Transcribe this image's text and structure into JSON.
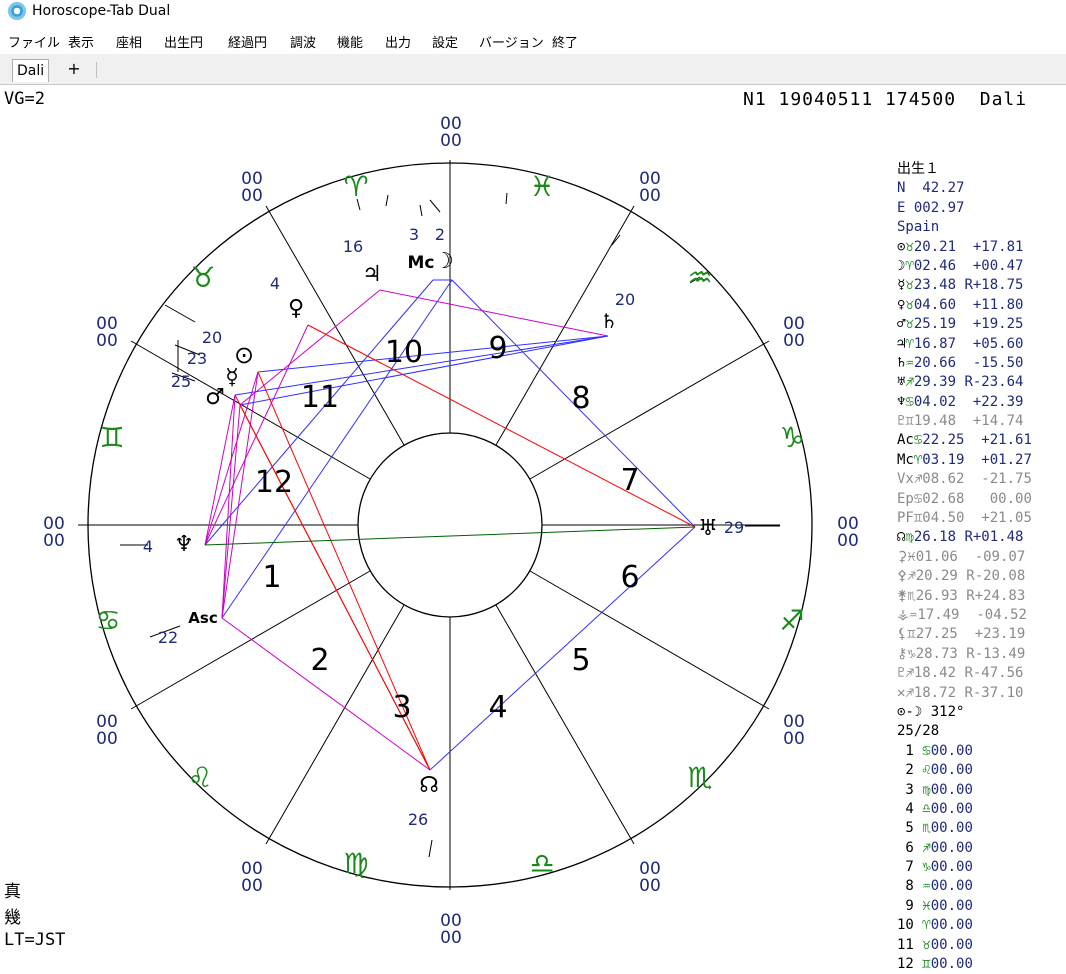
{
  "window": {
    "title": "Horoscope-Tab Dual"
  },
  "menu": [
    "ファイル",
    "表示",
    "座相",
    "出生円",
    "経過円",
    "調波",
    "機能",
    "出力",
    "設定",
    "バージョン",
    "終了"
  ],
  "tabs": {
    "active": "Dali",
    "add": "+"
  },
  "header": {
    "left": "VG=2",
    "right": "N1 19040511 174500  Dali"
  },
  "chart": {
    "ring_labels": "00",
    "houses": [
      "1",
      "2",
      "3",
      "4",
      "5",
      "6",
      "7",
      "8",
      "9",
      "10",
      "11",
      "12"
    ],
    "signs": [
      {
        "name": "aries",
        "glyph": "♈"
      },
      {
        "name": "taurus",
        "glyph": "♉"
      },
      {
        "name": "gemini",
        "glyph": "♊"
      },
      {
        "name": "cancer",
        "glyph": "♋"
      },
      {
        "name": "leo",
        "glyph": "♌"
      },
      {
        "name": "virgo",
        "glyph": "♍"
      },
      {
        "name": "libra",
        "glyph": "♎"
      },
      {
        "name": "scorpio",
        "glyph": "♏"
      },
      {
        "name": "sagittarius",
        "glyph": "♐"
      },
      {
        "name": "capricorn",
        "glyph": "♑"
      },
      {
        "name": "aquarius",
        "glyph": "♒"
      },
      {
        "name": "pisces",
        "glyph": "♓"
      }
    ],
    "planets": [
      {
        "name": "jupiter",
        "glyph": "♃"
      },
      {
        "name": "mc",
        "glyph": "Mc"
      },
      {
        "name": "moon",
        "glyph": "☽"
      },
      {
        "name": "venus",
        "glyph": "♀"
      },
      {
        "name": "sun",
        "glyph": "⊙"
      },
      {
        "name": "mercury",
        "glyph": "☿"
      },
      {
        "name": "mars",
        "glyph": "♂"
      },
      {
        "name": "saturn",
        "glyph": "♄"
      },
      {
        "name": "uranus",
        "glyph": "♅"
      },
      {
        "name": "neptune",
        "glyph": "♆"
      },
      {
        "name": "asc",
        "glyph": "Asc"
      },
      {
        "name": "node",
        "glyph": "☊"
      }
    ],
    "degree_labels": {
      "d16": "16",
      "d3": "3",
      "d2": "2",
      "d4": "4",
      "d20a": "20",
      "d23": "23",
      "d25": "25",
      "d20b": "20",
      "d29": "29",
      "d4n": "4",
      "d22": "22",
      "d26": "26"
    },
    "colors": {
      "circle": "#000000",
      "label": "#1f2a7a",
      "sign": "#1a8a1a",
      "blue": "#3030ff",
      "red": "#ff0000",
      "magenta": "#cc00cc",
      "green": "#006000"
    }
  },
  "side": {
    "title": "出生１",
    "lat": "N  42.27",
    "lon": "E 002.97",
    "place": "Spain",
    "planets": [
      {
        "g": "⊙",
        "s": "♉",
        "text": "20.21  +17.81",
        "c": "navy"
      },
      {
        "g": "☽",
        "s": "♈",
        "text": "02.46  +00.47",
        "c": "navy"
      },
      {
        "g": "☿",
        "s": "♉",
        "text": "23.48 R+18.75",
        "c": "navy"
      },
      {
        "g": "♀",
        "s": "♉",
        "text": "04.60  +11.80",
        "c": "navy"
      },
      {
        "g": "♂",
        "s": "♉",
        "text": "25.19  +19.25",
        "c": "navy"
      },
      {
        "g": "♃",
        "s": "♈",
        "text": "16.87  +05.60",
        "c": "navy"
      },
      {
        "g": "♄",
        "s": "♒",
        "text": "20.66  -15.50",
        "c": "navy"
      },
      {
        "g": "♅",
        "s": "♐",
        "text": "29.39 R-23.64",
        "c": "navy"
      },
      {
        "g": "♆",
        "s": "♋",
        "text": "04.02  +22.39",
        "c": "navy"
      },
      {
        "g": "♇",
        "s": "♊",
        "text": "19.48  +14.74",
        "c": "grey"
      },
      {
        "g": "Ac",
        "s": "♋",
        "text": "22.25  +21.61",
        "c": "navy"
      },
      {
        "g": "Mc",
        "s": "♈",
        "text": "03.19  +01.27",
        "c": "navy"
      },
      {
        "g": "Vx",
        "s": "♐",
        "text": "08.62  -21.75",
        "c": "grey"
      },
      {
        "g": "Ep",
        "s": "♋",
        "text": "02.68   00.00",
        "c": "grey"
      },
      {
        "g": "PF",
        "s": "♊",
        "text": "04.50  +21.05",
        "c": "grey"
      },
      {
        "g": "☊",
        "s": "♍",
        "text": "26.18 R+01.48",
        "c": "navy"
      },
      {
        "g": "⚳",
        "s": "♓",
        "text": "01.06  -09.07",
        "c": "grey"
      },
      {
        "g": "⚴",
        "s": "♐",
        "text": "20.29 R-20.08",
        "c": "grey"
      },
      {
        "g": "⚵",
        "s": "♏",
        "text": "26.93 R+24.83",
        "c": "grey"
      },
      {
        "g": "⚶",
        "s": "♒",
        "text": "17.49  -04.52",
        "c": "grey"
      },
      {
        "g": "⚸",
        "s": "♊",
        "text": "27.25  +23.19",
        "c": "grey"
      },
      {
        "g": "⚷",
        "s": "♑",
        "text": "28.73 R-13.49",
        "c": "grey"
      },
      {
        "g": "♇",
        "s": "♐",
        "text": "18.42 R-47.56",
        "c": "grey"
      },
      {
        "g": "✕",
        "s": "♐",
        "text": "18.72 R-37.10",
        "c": "grey"
      }
    ],
    "sunmoon": "⊙-☽ 312°",
    "ratio": "25/28",
    "cusps": [
      {
        "n": " 1",
        "s": "♋",
        "v": "00.00"
      },
      {
        "n": " 2",
        "s": "♌",
        "v": "00.00"
      },
      {
        "n": " 3",
        "s": "♍",
        "v": "00.00"
      },
      {
        "n": " 4",
        "s": "♎",
        "v": "00.00"
      },
      {
        "n": " 5",
        "s": "♏",
        "v": "00.00"
      },
      {
        "n": " 6",
        "s": "♐",
        "v": "00.00"
      },
      {
        "n": " 7",
        "s": "♑",
        "v": "00.00"
      },
      {
        "n": " 8",
        "s": "♒",
        "v": "00.00"
      },
      {
        "n": " 9",
        "s": "♓",
        "v": "00.00"
      },
      {
        "n": "10",
        "s": "♈",
        "v": "00.00"
      },
      {
        "n": "11",
        "s": "♉",
        "v": "00.00"
      },
      {
        "n": "12",
        "s": "♊",
        "v": "00.00"
      }
    ]
  },
  "bottom_left": {
    "line1": "真",
    "line2": "幾",
    "line3": "LT=JST"
  }
}
